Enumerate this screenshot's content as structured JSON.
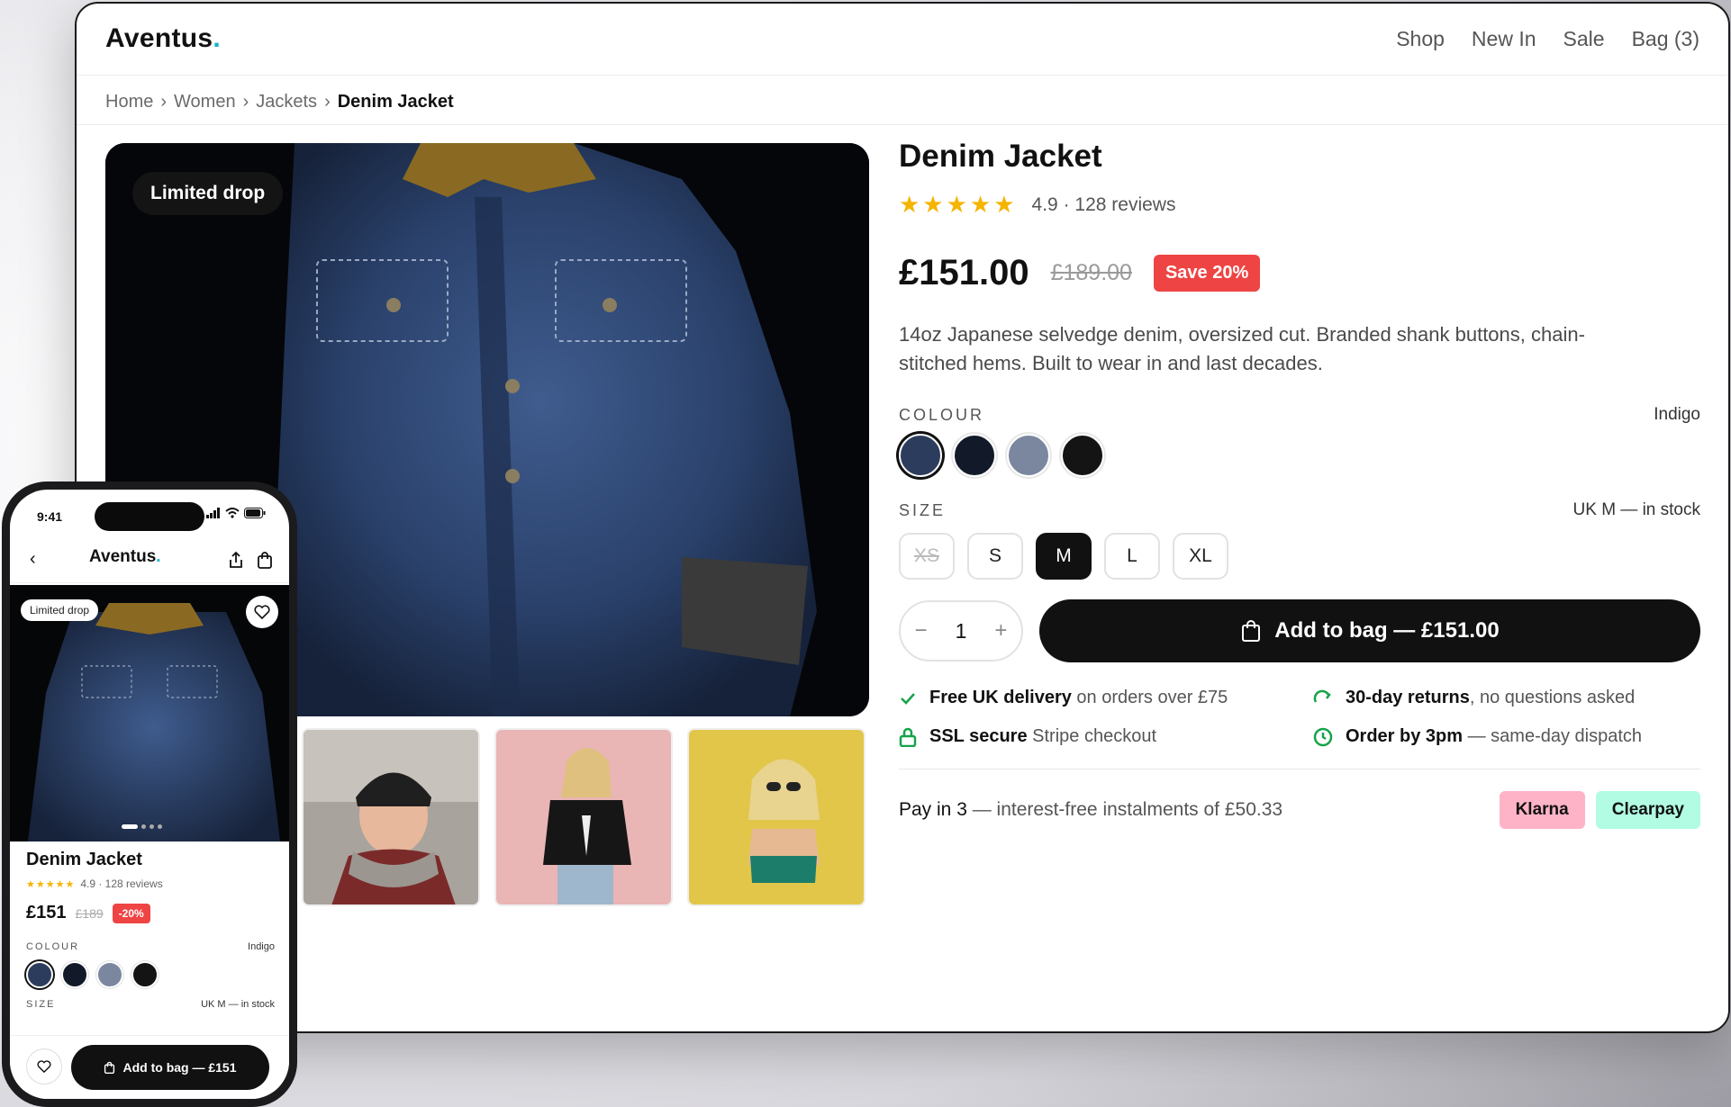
{
  "brand": {
    "name": "Aventus",
    "dot": ".",
    "accent": "#11b3c9"
  },
  "nav": {
    "items": [
      "Shop",
      "New In",
      "Sale",
      "Bag (3)"
    ]
  },
  "breadcrumb": {
    "items": [
      "Home",
      "Women",
      "Jackets"
    ],
    "current": "Denim Jacket",
    "separator": "›"
  },
  "gallery": {
    "badge": "Limited drop",
    "thumbnails": [
      "denim-jacket-hero",
      "woman-beanie-scarf",
      "woman-skeleton-tee",
      "woman-sunglasses-yellow"
    ]
  },
  "product": {
    "title": "Denim Jacket",
    "stars": "★★★★★",
    "rating_text": "4.9 · 128 reviews",
    "price": "£151.00",
    "was_price": "£189.00",
    "save_badge": "Save 20%",
    "description": "14oz Japanese selvedge denim, oversized cut. Branded shank buttons, chain-stitched hems. Built to wear in and last decades.",
    "colour_label": "COLOUR",
    "colour_selected": "Indigo",
    "colours": [
      "#2c3c5c",
      "#121a2a",
      "#7b879f",
      "#141414"
    ],
    "size_label": "SIZE",
    "size_status": "UK M — in stock",
    "sizes": [
      {
        "label": "XS",
        "state": "unavailable"
      },
      {
        "label": "S",
        "state": "available"
      },
      {
        "label": "M",
        "state": "selected"
      },
      {
        "label": "L",
        "state": "available"
      },
      {
        "label": "XL",
        "state": "available"
      }
    ],
    "quantity": "1",
    "qty_minus": "−",
    "qty_plus": "+",
    "add_to_bag": "Add to bag — £151.00"
  },
  "perks": [
    {
      "icon": "check-icon",
      "bold": "Free UK delivery",
      "text": " on orders over £75"
    },
    {
      "icon": "returns-icon",
      "bold": "30-day returns",
      "text": ", no questions asked"
    },
    {
      "icon": "lock-icon",
      "bold": "SSL secure",
      "text": " Stripe checkout"
    },
    {
      "icon": "clock-icon",
      "bold": "Order by 3pm",
      "text": " — same-day dispatch"
    }
  ],
  "pay": {
    "bold": "Pay in 3",
    "text": " — interest-free instalments of £50.33",
    "klarna": "Klarna",
    "clearpay": "Clearpay"
  },
  "mobile": {
    "time": "9:41",
    "badge": "Limited drop",
    "title": "Denim Jacket",
    "stars": "★★★★★",
    "rating_text": "4.9 · 128 reviews",
    "price": "£151",
    "was_price": "£189",
    "save_badge": "-20%",
    "colour_label": "COLOUR",
    "colour_selected": "Indigo",
    "size_label": "SIZE",
    "size_status": "UK M — in stock",
    "add_to_bag": "Add to bag — £151"
  }
}
